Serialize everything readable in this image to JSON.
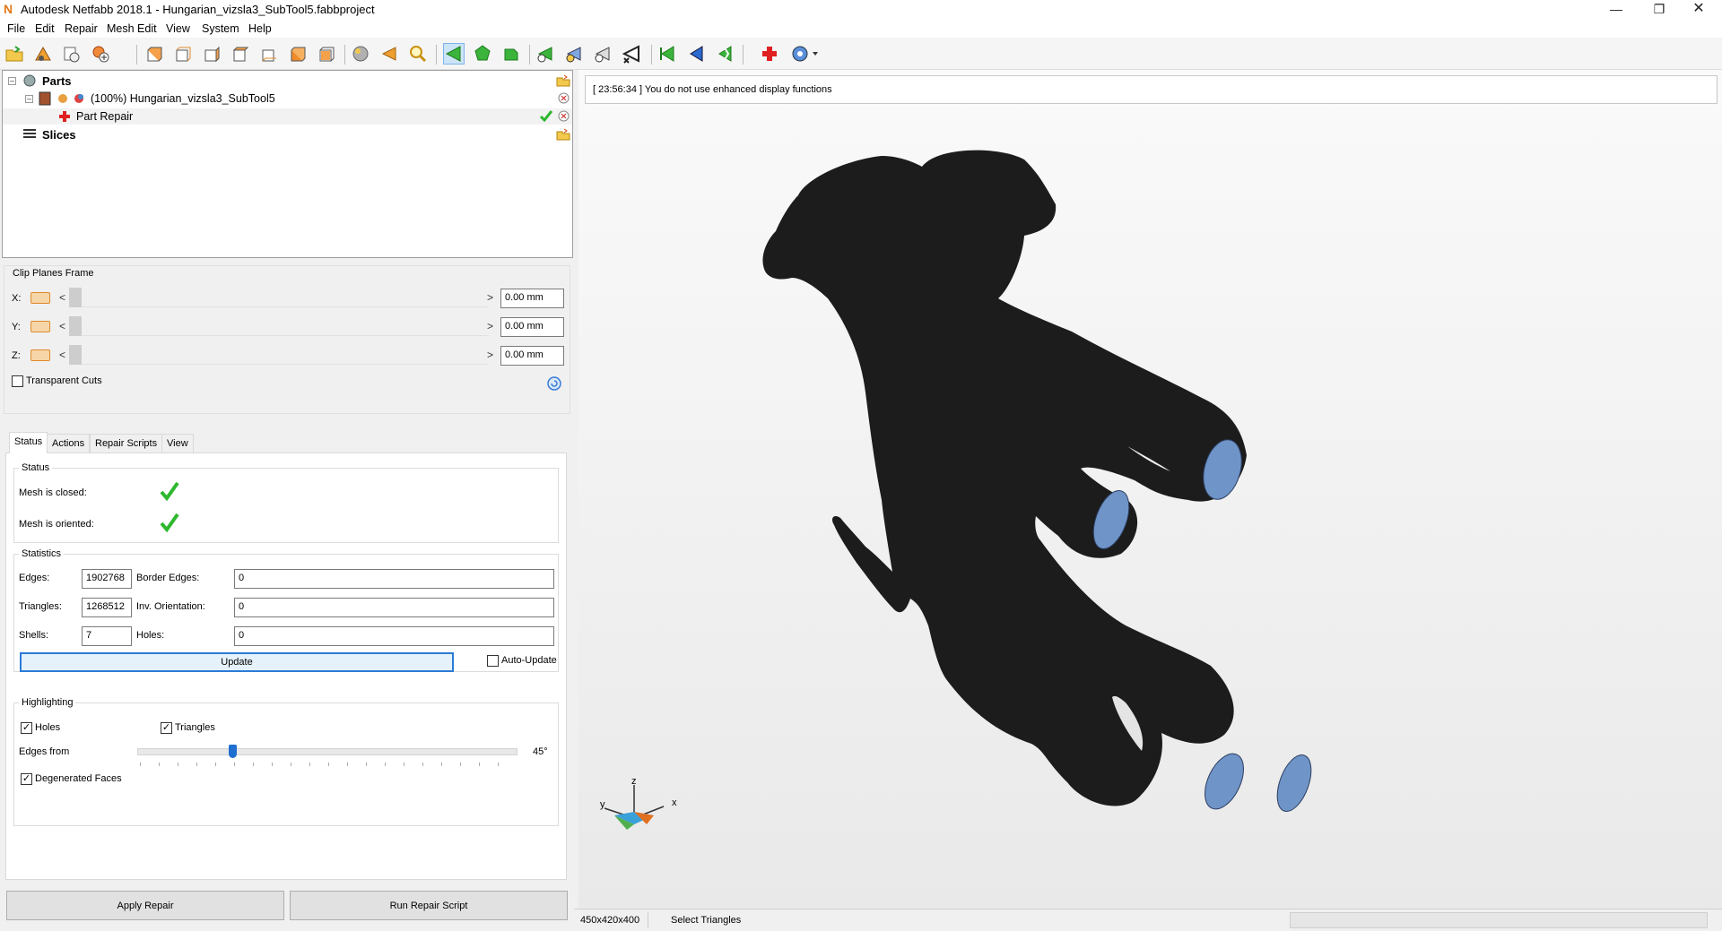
{
  "window": {
    "title": "Autodesk Netfabb 2018.1 - Hungarian_vizsla3_SubTool5.fabbproject",
    "minimize_icon": "minimize-icon",
    "restore_icon": "restore-icon",
    "close_icon": "close-icon"
  },
  "menu": [
    "File",
    "Edit",
    "Repair",
    "Mesh Edit",
    "View",
    "System",
    "Help"
  ],
  "tree": {
    "parts_label": "Parts",
    "part_name": "(100%) Hungarian_vizsla3_SubTool5",
    "repair_label": "Part Repair",
    "slices_label": "Slices"
  },
  "clip": {
    "title": "Clip Planes Frame",
    "x_label": "X:",
    "y_label": "Y:",
    "z_label": "Z:",
    "x_value": "0.00 mm",
    "y_value": "0.00 mm",
    "z_value": "0.00 mm",
    "left_arrow": "<",
    "right_arrow": ">",
    "transparent_cuts": "Transparent Cuts"
  },
  "tabs": [
    "Status",
    "Actions",
    "Repair Scripts",
    "View"
  ],
  "status": {
    "title": "Status",
    "mesh_closed": "Mesh is closed:",
    "mesh_oriented": "Mesh is oriented:"
  },
  "statistics": {
    "title": "Statistics",
    "edges_label": "Edges:",
    "edges_value": "1902768",
    "border_edges_label": "Border Edges:",
    "border_edges_value": "0",
    "triangles_label": "Triangles:",
    "triangles_value": "1268512",
    "inv_orientation_label": "Inv. Orientation:",
    "inv_orientation_value": "0",
    "shells_label": "Shells:",
    "shells_value": "7",
    "holes_label": "Holes:",
    "holes_value": "0",
    "update_button": "Update",
    "auto_update": "Auto-Update"
  },
  "highlighting": {
    "title": "Highlighting",
    "holes": "Holes",
    "triangles": "Triangles",
    "edges_from": "Edges from",
    "angle": "45°",
    "angle_fraction": 0.25,
    "degenerated_faces": "Degenerated Faces"
  },
  "buttons": {
    "apply_repair": "Apply Repair",
    "run_repair_script": "Run Repair Script"
  },
  "viewport": {
    "message": "[ 23:56:34 ] You do not use enhanced display functions",
    "axis_z": "z",
    "axis_x": "x",
    "axis_y": "y"
  },
  "statusbar": {
    "dimensions": "450x420x400",
    "mode": "Select Triangles"
  },
  "colors": {
    "accent": "#2b7bd6",
    "mesh": "#1c1c1c",
    "hole_fill": "#6f94c8",
    "ok_green": "#2eb82e"
  }
}
